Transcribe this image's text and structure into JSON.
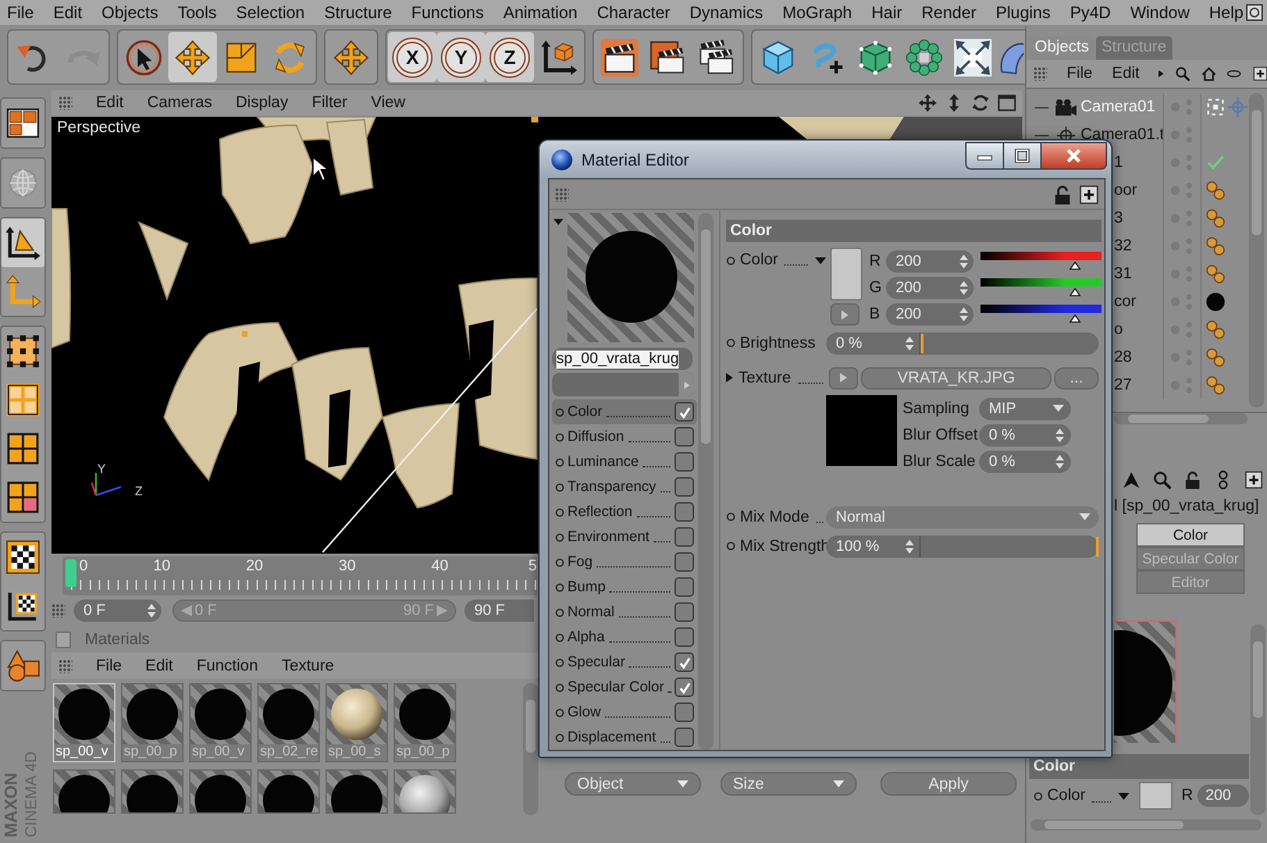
{
  "menu_bar": {
    "items": [
      "File",
      "Edit",
      "Objects",
      "Tools",
      "Selection",
      "Structure",
      "Functions",
      "Animation",
      "Character",
      "Dynamics",
      "MoGraph",
      "Hair",
      "Render",
      "Plugins",
      "Py4D",
      "Window",
      "Help"
    ]
  },
  "toolbar": [
    {
      "tools": [
        {
          "kind": "undo",
          "selected": false
        },
        {
          "kind": "redo",
          "selected": false
        }
      ]
    },
    {
      "tools": [
        {
          "kind": "live_select",
          "selected": false
        },
        {
          "kind": "move",
          "selected": true
        },
        {
          "kind": "scale",
          "selected": false
        },
        {
          "kind": "rotate",
          "selected": false
        }
      ]
    },
    {
      "tools": [
        {
          "kind": "move",
          "selected": false
        }
      ]
    },
    {
      "tools": [
        {
          "kind": "axis",
          "label": "X",
          "selected": true
        },
        {
          "kind": "axis",
          "label": "Y",
          "selected": true
        },
        {
          "kind": "axis",
          "label": "Z",
          "selected": true
        },
        {
          "kind": "world",
          "selected": false
        }
      ]
    },
    {
      "tools": [
        {
          "kind": "render_view",
          "selected": false
        },
        {
          "kind": "render_picture",
          "selected": false
        },
        {
          "kind": "render_settings",
          "selected": false
        }
      ]
    },
    {
      "tools": [
        {
          "kind": "cube",
          "selected": false
        },
        {
          "kind": "spline",
          "selected": false
        },
        {
          "kind": "nurbs",
          "selected": false
        },
        {
          "kind": "array",
          "selected": false
        },
        {
          "kind": "deformer",
          "selected": false
        },
        {
          "kind": "scene",
          "selected": false
        }
      ]
    }
  ],
  "left_tools": [
    {
      "tools": [
        {
          "kind": "layout",
          "selected": false
        }
      ]
    },
    {
      "tools": [
        {
          "kind": "globe",
          "selected": false
        }
      ]
    },
    {
      "tools": [
        {
          "kind": "model",
          "selected": true
        },
        {
          "kind": "object_axis",
          "selected": false
        }
      ]
    },
    {
      "tools": [
        {
          "kind": "points",
          "selected": false
        },
        {
          "kind": "edges",
          "selected": false
        },
        {
          "kind": "polygons",
          "selected": false
        },
        {
          "kind": "uv_polygons",
          "selected": false
        }
      ]
    },
    {
      "tools": [
        {
          "kind": "texture",
          "selected": false
        },
        {
          "kind": "texture_axis",
          "selected": false
        }
      ]
    },
    {
      "tools": [
        {
          "kind": "snap",
          "selected": false
        }
      ]
    }
  ],
  "logo": {
    "brand": "MAXON",
    "product": "CINEMA 4D"
  },
  "viewport": {
    "menu": [
      "Edit",
      "Cameras",
      "Display",
      "Filter",
      "View"
    ],
    "title": "Perspective",
    "axis_labels": [
      "Y",
      "Z"
    ]
  },
  "timeline": {
    "ticks": [
      "0",
      "10",
      "20",
      "30",
      "40",
      "5"
    ],
    "level": 0,
    "current_frame": "0 F",
    "range_start": "0 F",
    "range_end": "90 F",
    "end_frame": "90 F"
  },
  "materials": {
    "title": "Materials",
    "menu": [
      "File",
      "Edit",
      "Function",
      "Texture"
    ],
    "items": [
      {
        "name": "sp_00_v",
        "kind": "black",
        "selected": true
      },
      {
        "name": "sp_00_p",
        "kind": "black",
        "selected": false
      },
      {
        "name": "sp_00_v",
        "kind": "black",
        "selected": false
      },
      {
        "name": "sp_02_re",
        "kind": "black",
        "selected": false
      },
      {
        "name": "sp_00_s",
        "kind": "beige",
        "selected": false
      },
      {
        "name": "sp_00_p",
        "kind": "black",
        "selected": false
      },
      {
        "kind": "black",
        "selected": false
      },
      {
        "kind": "black",
        "selected": false
      },
      {
        "kind": "black",
        "selected": false
      },
      {
        "kind": "black",
        "selected": false
      },
      {
        "kind": "black",
        "selected": false
      },
      {
        "kind": "grey",
        "selected": false
      }
    ]
  },
  "coordinates": {
    "controls": [
      {
        "kind": "dropdown",
        "label": "Object"
      },
      {
        "kind": "dropdown",
        "label": "Size"
      },
      {
        "kind": "button",
        "label": "Apply"
      }
    ]
  },
  "objects_panel": {
    "tabs": [
      {
        "label": "Objects",
        "selected": true
      },
      {
        "label": "Structure",
        "selected": false
      }
    ],
    "menu": [
      "File",
      "Edit"
    ],
    "rows": [
      {
        "name": "Camera01",
        "kind": "camera",
        "selected": true,
        "tags": [
          {
            "kind": "display"
          },
          {
            "kind": "target"
          }
        ]
      },
      {
        "name": "Camera01.t",
        "kind": "null",
        "selected": false
      },
      {
        "name": "1",
        "kind": "object",
        "selected": false,
        "tags": [
          {
            "kind": "check"
          }
        ]
      },
      {
        "name": "oor",
        "kind": "object",
        "selected": false,
        "tags": [
          {
            "kind": "texture"
          }
        ]
      },
      {
        "name": "3",
        "kind": "object",
        "selected": false,
        "tags": [
          {
            "kind": "texture"
          }
        ]
      },
      {
        "name": "32",
        "kind": "object",
        "selected": false,
        "tags": [
          {
            "kind": "texture"
          }
        ]
      },
      {
        "name": "31",
        "kind": "object",
        "selected": false,
        "tags": [
          {
            "kind": "texture"
          }
        ]
      },
      {
        "name": "cor",
        "kind": "object",
        "selected": false,
        "tags": [
          {
            "kind": "material"
          }
        ]
      },
      {
        "name": "o",
        "kind": "object",
        "selected": false,
        "tags": [
          {
            "kind": "texture"
          }
        ]
      },
      {
        "name": "28",
        "kind": "object",
        "selected": false,
        "tags": [
          {
            "kind": "texture"
          }
        ]
      },
      {
        "name": "27",
        "kind": "object",
        "selected": false,
        "tags": [
          {
            "kind": "texture"
          }
        ]
      }
    ]
  },
  "attributes": {
    "title": "l [sp_00_vrata_krug]",
    "tabs": [
      {
        "label": "Color",
        "selected": true
      },
      {
        "label": "Specular Color",
        "selected": false
      },
      {
        "label": "Editor",
        "selected": false
      }
    ],
    "section": "Color",
    "color_row": {
      "label": "Color",
      "channel": "R",
      "value": "200"
    }
  },
  "material_editor": {
    "title": "Material Editor",
    "name": "sp_00_vrata_krug",
    "channels": [
      {
        "label": "Color",
        "checked": true,
        "selected": true
      },
      {
        "label": "Diffusion",
        "checked": false,
        "selected": false
      },
      {
        "label": "Luminance",
        "checked": false,
        "selected": false
      },
      {
        "label": "Transparency",
        "checked": false,
        "selected": false
      },
      {
        "label": "Reflection",
        "checked": false,
        "selected": false
      },
      {
        "label": "Environment",
        "checked": false,
        "selected": false
      },
      {
        "label": "Fog",
        "checked": false,
        "selected": false
      },
      {
        "label": "Bump",
        "checked": false,
        "selected": false
      },
      {
        "label": "Normal",
        "checked": false,
        "selected": false
      },
      {
        "label": "Alpha",
        "checked": false,
        "selected": false
      },
      {
        "label": "Specular",
        "checked": true,
        "selected": false
      },
      {
        "label": "Specular Color",
        "checked": true,
        "selected": false
      },
      {
        "label": "Glow",
        "checked": false,
        "selected": false
      },
      {
        "label": "Displacement",
        "checked": false,
        "selected": false
      }
    ],
    "section": "Color",
    "color": {
      "label": "Color",
      "channels": [
        {
          "label": "R",
          "value": "200",
          "level": 0.78,
          "color": "#e82020"
        },
        {
          "label": "G",
          "value": "200",
          "level": 0.78,
          "color": "#28c828"
        },
        {
          "label": "B",
          "value": "200",
          "level": 0.78,
          "color": "#2028e0"
        }
      ]
    },
    "brightness": {
      "label": "Brightness",
      "value": "0 %",
      "level": 0
    },
    "texture": {
      "label": "Texture",
      "file": "VRATA_KR.JPG",
      "browse": "...",
      "settings": [
        {
          "label": "Sampling",
          "value": "MIP",
          "kind": "dropdown"
        },
        {
          "label": "Blur Offset",
          "value": "0 %",
          "kind": "number"
        },
        {
          "label": "Blur Scale",
          "value": "0 %",
          "kind": "number"
        }
      ]
    },
    "mix_mode": {
      "label": "Mix Mode",
      "value": "Normal"
    },
    "mix_strength": {
      "label": "Mix Strength",
      "value": "100 %",
      "level": 1
    }
  }
}
